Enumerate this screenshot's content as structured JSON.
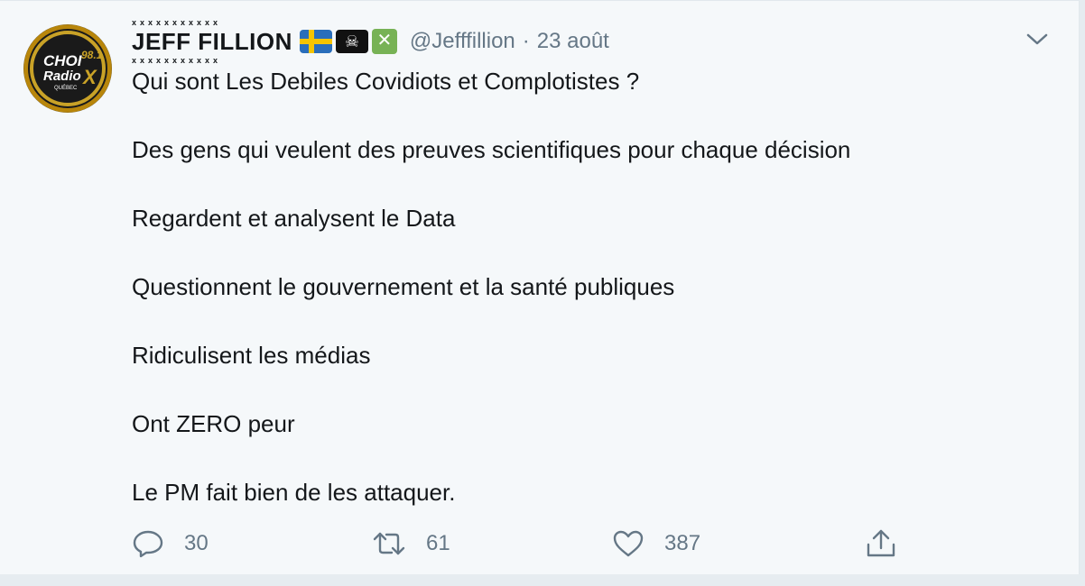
{
  "tweet": {
    "author": {
      "name": "JEFF FILLION",
      "handle": "@Jefffillion",
      "avatar": {
        "brand": "CHOI 98.1 Radio X Québec",
        "icon": "choi-radio-x-logo-icon"
      },
      "emojis": [
        "swedish-flag-icon",
        "pirate-flag-icon",
        "cross-mark-icon"
      ]
    },
    "separator": "·",
    "date": "23 août",
    "lines": [
      "Qui sont Les Debiles Covidiots et Complotistes ?",
      "Des gens qui veulent des preuves scientifiques pour chaque décision",
      "Regardent et analysent le Data",
      "Questionnent le gouvernement et la santé publiques",
      "Ridiculisent les médias",
      "Ont ZERO peur",
      "Le PM fait bien de les attaquer."
    ],
    "actions": {
      "reply_count": "30",
      "retweet_count": "61",
      "like_count": "387"
    }
  },
  "colors": {
    "background": "#f5f8fa",
    "text": "#14171a",
    "muted": "#657786",
    "flag_blue": "#2a6ebb",
    "flag_yellow": "#f5c400",
    "cross_green": "#77b255"
  }
}
